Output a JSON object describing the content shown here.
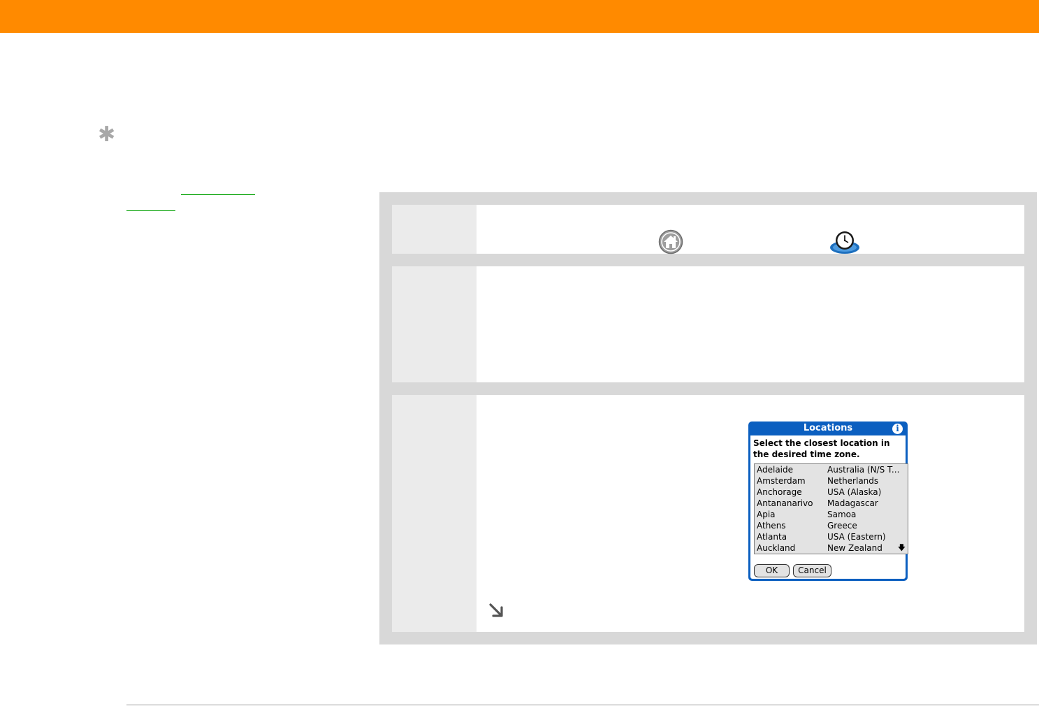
{
  "colors": {
    "accent": "#ff8a00",
    "link": "#00a000",
    "panel": "#d8d8d8",
    "step_number_bg": "#ebebeb",
    "dialog_blue": "#0b5fc0"
  },
  "icons": {
    "tip": "asterisk-tip-icon",
    "home": "home-icon",
    "world_clock": "world-clock-icon",
    "continue": "continue-arrow-icon"
  },
  "dialog": {
    "title": "Locations",
    "info_glyph": "i",
    "prompt": "Select the closest location in the desired time zone.",
    "locations": [
      {
        "city": "Adelaide",
        "country": "Australia (N/S T..."
      },
      {
        "city": "Amsterdam",
        "country": "Netherlands"
      },
      {
        "city": "Anchorage",
        "country": "USA (Alaska)"
      },
      {
        "city": "Antananarivo",
        "country": "Madagascar"
      },
      {
        "city": "Apia",
        "country": "Samoa"
      },
      {
        "city": "Athens",
        "country": "Greece"
      },
      {
        "city": "Atlanta",
        "country": "USA (Eastern)"
      },
      {
        "city": "Auckland",
        "country": "New Zealand"
      }
    ],
    "scroll_glyph": "🡇",
    "ok_label": "OK",
    "cancel_label": "Cancel"
  },
  "glyphs": {
    "tip": "✱",
    "continue": "↘"
  }
}
